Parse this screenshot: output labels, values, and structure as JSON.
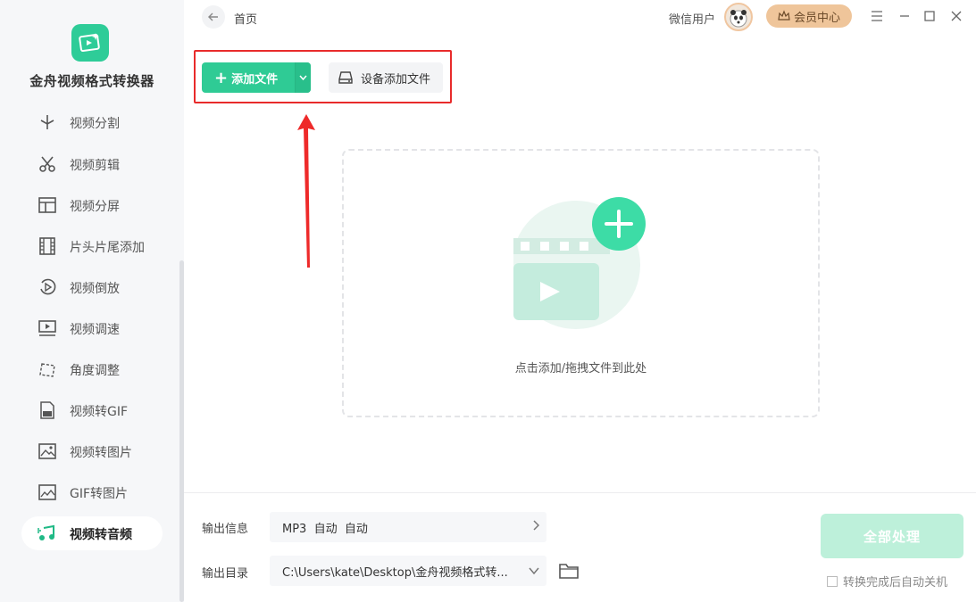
{
  "app": {
    "name": "金舟视频格式转换器"
  },
  "sidebar": {
    "items": [
      {
        "label": "视频分割",
        "icon": "video-split-icon",
        "active": false
      },
      {
        "label": "视频剪辑",
        "icon": "scissors-icon",
        "active": false
      },
      {
        "label": "视频分屏",
        "icon": "split-screen-icon",
        "active": false
      },
      {
        "label": "片头片尾添加",
        "icon": "film-strip-icon",
        "active": false
      },
      {
        "label": "视频倒放",
        "icon": "reverse-play-icon",
        "active": false
      },
      {
        "label": "视频调速",
        "icon": "speed-icon",
        "active": false
      },
      {
        "label": "角度调整",
        "icon": "rotate-icon",
        "active": false
      },
      {
        "label": "视频转GIF",
        "icon": "gif-icon",
        "active": false
      },
      {
        "label": "视频转图片",
        "icon": "image-icon",
        "active": false
      },
      {
        "label": "GIF转图片",
        "icon": "gif-image-icon",
        "active": false
      },
      {
        "label": "视频转音频",
        "icon": "music-note-icon",
        "active": true
      }
    ]
  },
  "header": {
    "breadcrumb": "首页",
    "user_name": "微信用户",
    "vip_label": "会员中心"
  },
  "toolbar": {
    "add_file_label": "添加文件",
    "device_add_label": "设备添加文件"
  },
  "dropzone": {
    "hint": "点击添加/拖拽文件到此处"
  },
  "footer": {
    "output_info_label": "输出信息",
    "output_info_value": "MP3  自动  自动",
    "output_dir_label": "输出目录",
    "output_dir_value": "C:\\Users\\kate\\Desktop\\金舟视频格式转...",
    "process_all_label": "全部处理",
    "shutdown_label": "转换完成后自动关机"
  },
  "colors": {
    "accent": "#2fcb95",
    "highlight": "#e82b2b",
    "vip": "#efc59a",
    "process_disabled": "#bdf0da"
  }
}
